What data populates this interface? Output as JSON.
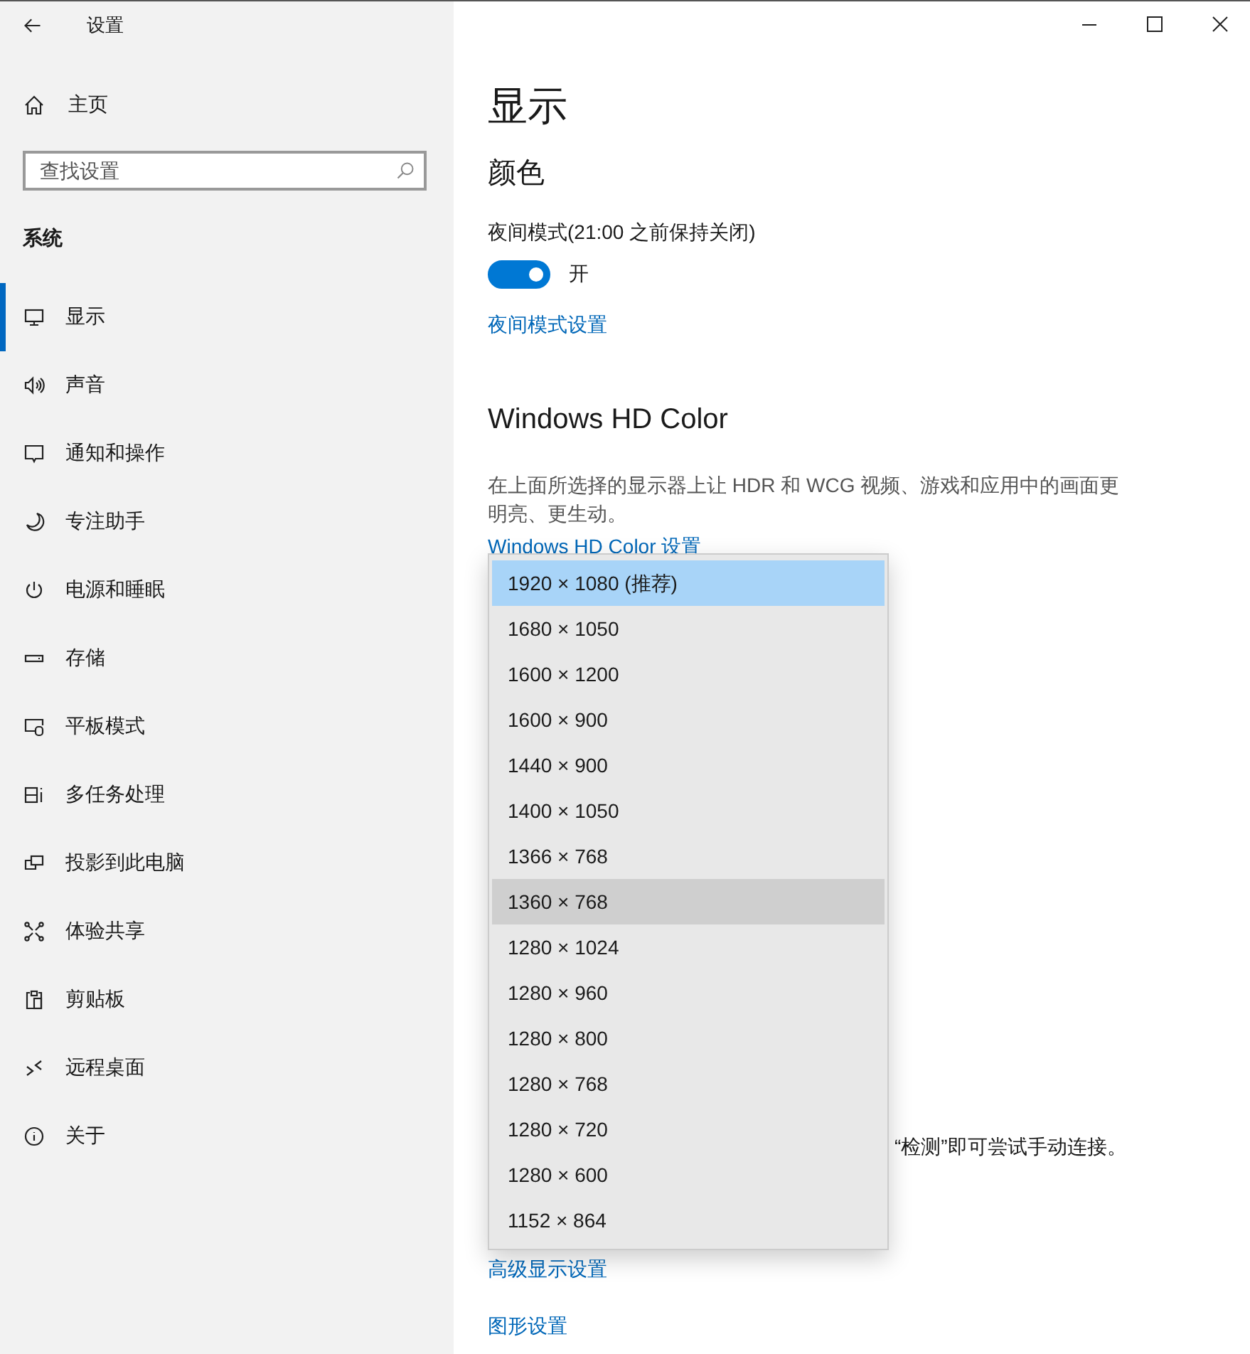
{
  "window": {
    "title": "设置"
  },
  "sidebar": {
    "home": "主页",
    "search": {
      "placeholder": "查找设置"
    },
    "section": "系统",
    "items": [
      {
        "label": "显示",
        "selected": true
      },
      {
        "label": "声音",
        "selected": false
      },
      {
        "label": "通知和操作",
        "selected": false
      },
      {
        "label": "专注助手",
        "selected": false
      },
      {
        "label": "电源和睡眠",
        "selected": false
      },
      {
        "label": "存储",
        "selected": false
      },
      {
        "label": "平板模式",
        "selected": false
      },
      {
        "label": "多任务处理",
        "selected": false
      },
      {
        "label": "投影到此电脑",
        "selected": false
      },
      {
        "label": "体验共享",
        "selected": false
      },
      {
        "label": "剪贴板",
        "selected": false
      },
      {
        "label": "远程桌面",
        "selected": false
      },
      {
        "label": "关于",
        "selected": false
      }
    ]
  },
  "main": {
    "title": "显示",
    "color_section": {
      "heading": "颜色",
      "night_light": {
        "label": "夜间模式(21:00 之前保持关闭)",
        "on": true,
        "state_text": "开"
      },
      "link": "夜间模式设置"
    },
    "hd_section": {
      "heading": "Windows HD Color",
      "description": "在上面所选择的显示器上让 HDR 和 WCG 视频、游戏和应用中的画面更明亮、更生动。",
      "link": "Windows HD Color 设置"
    },
    "partial_text": "“检测”即可尝试手动连接。",
    "links": [
      "高级显示设置",
      "图形设置"
    ]
  },
  "resolution_dropdown": {
    "options": [
      {
        "label": "1920 × 1080 (推荐)",
        "selected": true,
        "hovered": false
      },
      {
        "label": "1680 × 1050",
        "selected": false,
        "hovered": false
      },
      {
        "label": "1600 × 1200",
        "selected": false,
        "hovered": false
      },
      {
        "label": "1600 × 900",
        "selected": false,
        "hovered": false
      },
      {
        "label": "1440 × 900",
        "selected": false,
        "hovered": false
      },
      {
        "label": "1400 × 1050",
        "selected": false,
        "hovered": false
      },
      {
        "label": "1366 × 768",
        "selected": false,
        "hovered": false
      },
      {
        "label": "1360 × 768",
        "selected": false,
        "hovered": true
      },
      {
        "label": "1280 × 1024",
        "selected": false,
        "hovered": false
      },
      {
        "label": "1280 × 960",
        "selected": false,
        "hovered": false
      },
      {
        "label": "1280 × 800",
        "selected": false,
        "hovered": false
      },
      {
        "label": "1280 × 768",
        "selected": false,
        "hovered": false
      },
      {
        "label": "1280 × 720",
        "selected": false,
        "hovered": false
      },
      {
        "label": "1280 × 600",
        "selected": false,
        "hovered": false
      },
      {
        "label": "1152 × 864",
        "selected": false,
        "hovered": false
      }
    ]
  }
}
